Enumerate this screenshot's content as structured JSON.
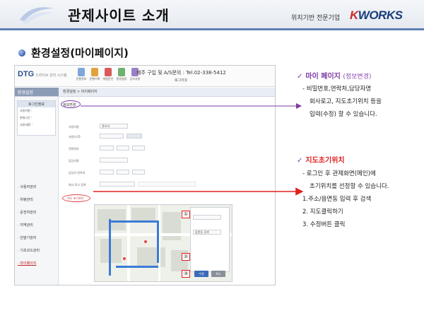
{
  "slide": {
    "title": "관제사이트 소개",
    "tagline": "위치기반 전문기업",
    "brand_prefix": "K",
    "brand_rest": "WORKS",
    "section_title": "환경설정(마이페이지)"
  },
  "screenshot": {
    "logo": "DTG",
    "logo_sub": "드라이브 관리 시스템",
    "toolbar": [
      "운행정보",
      "운행기록",
      "위험운전",
      "환경설정",
      "공지사항"
    ],
    "phone": "제주 구입 및 A/S문의 : Tel.02-338-5412",
    "phone_sub": "로그아웃",
    "nav_left": "환경설정",
    "breadcrumb": "환경설정  >  마이페이지",
    "side_box_title": "로그인정보",
    "side_box_rows": [
      "사용자명 :",
      "현재시간 :",
      "사용자ID :"
    ],
    "side_menu": [
      "사용자관리",
      "차량관리",
      "운전자관리",
      "지역관리",
      "단말기관리",
      "기초코드관리",
      "마이페이지"
    ],
    "form_title": "정보변경",
    "form_rows": [
      "사용자명",
      "사용자 ID",
      "전화번호",
      "담당자명",
      "담당자 연락처",
      "회사 로고 등록"
    ],
    "form_values": [
      "관리자",
      "",
      "",
      "",
      "",
      ""
    ],
    "map_location_label": "지도 초기위치",
    "panel_search": "읍면동 검색",
    "save_label": "수정",
    "cancel_label": "취소",
    "marker_labels": [
      "①",
      "②",
      "③"
    ]
  },
  "notes": {
    "mypage_title": "마이 페이지",
    "mypage_sub": "(정보변경)",
    "mypage_lines": [
      "- 비밀번호,연락처,담당자명",
      "회사로고, 지도초기위치 등을",
      "입력(수정) 할 수 있습니다."
    ],
    "map_title": "지도초기위치",
    "map_lines": [
      "- 로그인 후 관제화면(메인)에",
      "초기위치를 선정할 수 있습니다.",
      "1.주소/읍면동 입력 후 검색",
      "2. 지도클릭하기",
      "3. 수정버튼 클릭"
    ]
  },
  "colors": {
    "header_line": "#5f7fb2",
    "purple": "#7c3aa5",
    "red": "#e02020",
    "brand_navy": "#173d7a"
  }
}
